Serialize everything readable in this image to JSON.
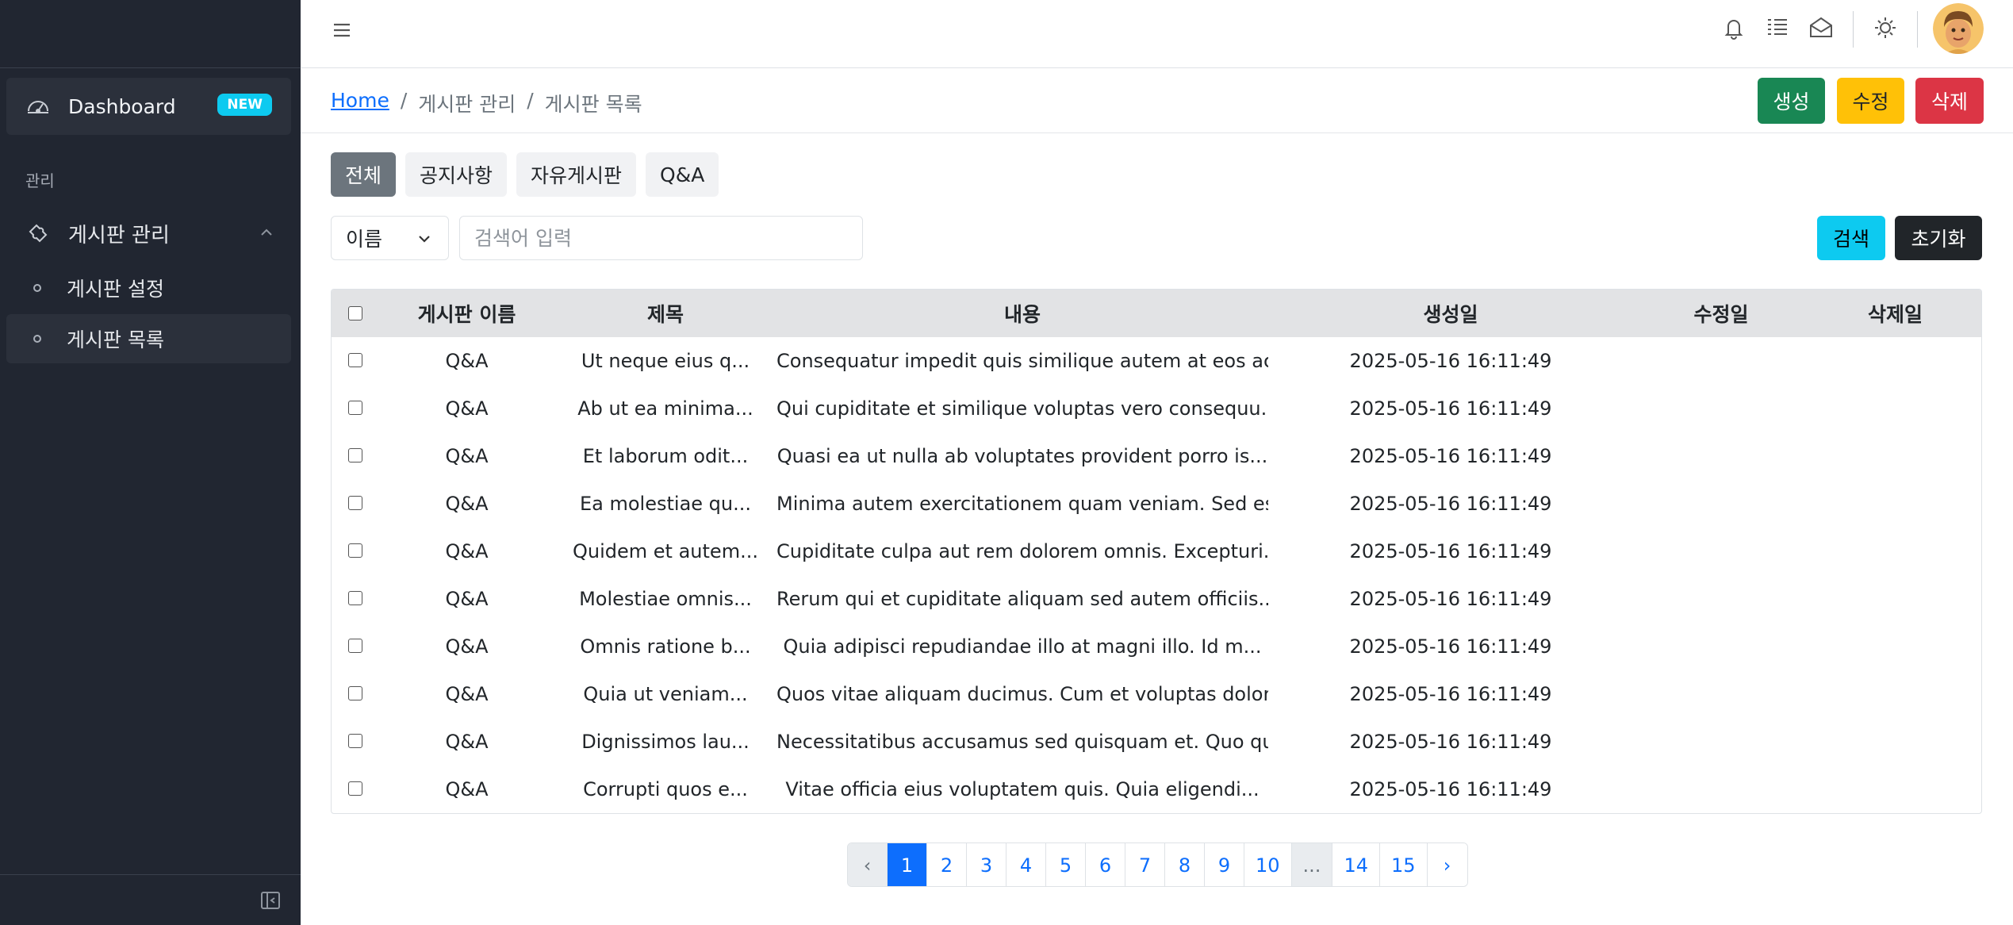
{
  "sidebar": {
    "dashboard_label": "Dashboard",
    "dashboard_badge": "NEW",
    "section_label": "관리",
    "group_label": "게시판 관리",
    "items": [
      {
        "label": "게시판 설정"
      },
      {
        "label": "게시판 목록"
      }
    ]
  },
  "header": {
    "icons": [
      "menu-icon",
      "bell-icon",
      "list-icon",
      "envelope-open-icon",
      "sun-icon",
      "avatar"
    ]
  },
  "breadcrumb": {
    "home": "Home",
    "sep": "/",
    "level1": "게시판 관리",
    "level2": "게시판 목록"
  },
  "actions": {
    "create": "생성",
    "edit": "수정",
    "delete": "삭제"
  },
  "tabs": [
    "전체",
    "공지사항",
    "자유게시판",
    "Q&A"
  ],
  "search": {
    "field_value": "이름",
    "placeholder": "검색어 입력",
    "search_label": "검색",
    "reset_label": "초기화"
  },
  "table": {
    "headers": [
      "게시판 이름",
      "제목",
      "내용",
      "생성일",
      "수정일",
      "삭제일"
    ],
    "rows": [
      {
        "board": "Q&A",
        "title": "Ut neque eius q...",
        "content": "Consequatur impedit quis similique autem at eos ac...",
        "created": "2025-05-16 16:11:49",
        "updated": "",
        "deleted": ""
      },
      {
        "board": "Q&A",
        "title": "Ab ut ea minima...",
        "content": "Qui cupiditate et similique voluptas vero consequu...",
        "created": "2025-05-16 16:11:49",
        "updated": "",
        "deleted": ""
      },
      {
        "board": "Q&A",
        "title": "Et laborum odit...",
        "content": "Quasi ea ut nulla ab voluptates provident porro is...",
        "created": "2025-05-16 16:11:49",
        "updated": "",
        "deleted": ""
      },
      {
        "board": "Q&A",
        "title": "Ea molestiae qu...",
        "content": "Minima autem exercitationem quam veniam. Sed est i...",
        "created": "2025-05-16 16:11:49",
        "updated": "",
        "deleted": ""
      },
      {
        "board": "Q&A",
        "title": "Quidem et autem...",
        "content": "Cupiditate culpa aut rem dolorem omnis. Excepturi...",
        "created": "2025-05-16 16:11:49",
        "updated": "",
        "deleted": ""
      },
      {
        "board": "Q&A",
        "title": "Molestiae omnis...",
        "content": "Rerum qui et cupiditate aliquam sed autem officiis...",
        "created": "2025-05-16 16:11:49",
        "updated": "",
        "deleted": ""
      },
      {
        "board": "Q&A",
        "title": "Omnis ratione b...",
        "content": "Quia adipisci repudiandae illo at magni illo. Id m...",
        "created": "2025-05-16 16:11:49",
        "updated": "",
        "deleted": ""
      },
      {
        "board": "Q&A",
        "title": "Quia ut veniam...",
        "content": "Quos vitae aliquam ducimus. Cum et voluptas dolore...",
        "created": "2025-05-16 16:11:49",
        "updated": "",
        "deleted": ""
      },
      {
        "board": "Q&A",
        "title": "Dignissimos lau...",
        "content": "Necessitatibus accusamus sed quisquam et. Quo quis...",
        "created": "2025-05-16 16:11:49",
        "updated": "",
        "deleted": ""
      },
      {
        "board": "Q&A",
        "title": "Corrupti quos e...",
        "content": "Vitae officia eius voluptatem quis. Quia eligendi...",
        "created": "2025-05-16 16:11:49",
        "updated": "",
        "deleted": ""
      }
    ]
  },
  "pagination": {
    "prev": "‹",
    "next": "›",
    "active": "1",
    "pages": [
      "1",
      "2",
      "3",
      "4",
      "5",
      "6",
      "7",
      "8",
      "9",
      "10",
      "...",
      "14",
      "15"
    ]
  },
  "colors": {
    "sidebar_bg": "#212631",
    "primary": "#0d6efd",
    "success": "#198754",
    "warning": "#ffc107",
    "danger": "#dc3545",
    "info": "#0dcaf0"
  }
}
